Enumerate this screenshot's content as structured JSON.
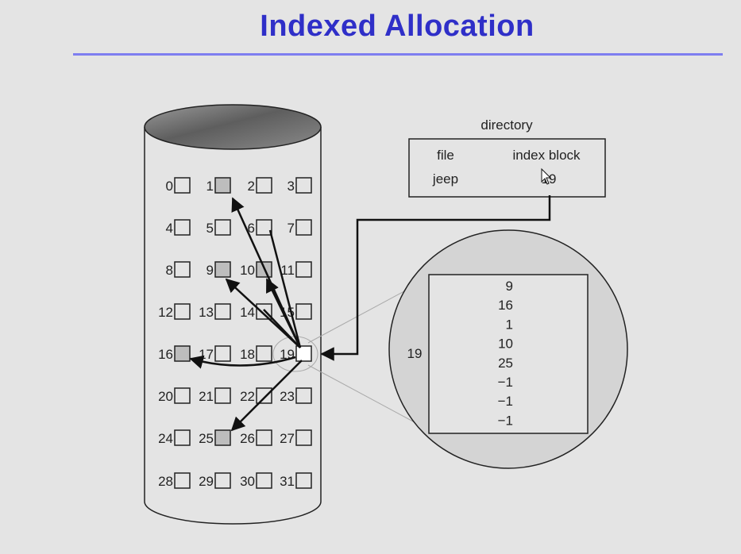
{
  "title": "Indexed Allocation",
  "directory": {
    "caption": "directory",
    "col_file": "file",
    "col_index_block": "index block",
    "entry_file": "jeep",
    "entry_index_block": "19"
  },
  "disk": {
    "blocks": [
      "0",
      "1",
      "2",
      "3",
      "4",
      "5",
      "6",
      "7",
      "8",
      "9",
      "10",
      "11",
      "12",
      "13",
      "14",
      "15",
      "16",
      "17",
      "18",
      "19",
      "20",
      "21",
      "22",
      "23",
      "24",
      "25",
      "26",
      "27",
      "28",
      "29",
      "30",
      "31"
    ],
    "shaded_blocks": [
      1,
      9,
      10,
      16,
      25
    ],
    "index_block_number": 19
  },
  "index_block": {
    "label": "19",
    "entries": [
      "9",
      "16",
      "1",
      "10",
      "25",
      "−1",
      "−1",
      "−1"
    ]
  },
  "colors": {
    "title": "#2f2fc8",
    "rule": "#7e7ef0",
    "background": "#e4e4e4",
    "shaded_block": "#bdbdbd"
  }
}
